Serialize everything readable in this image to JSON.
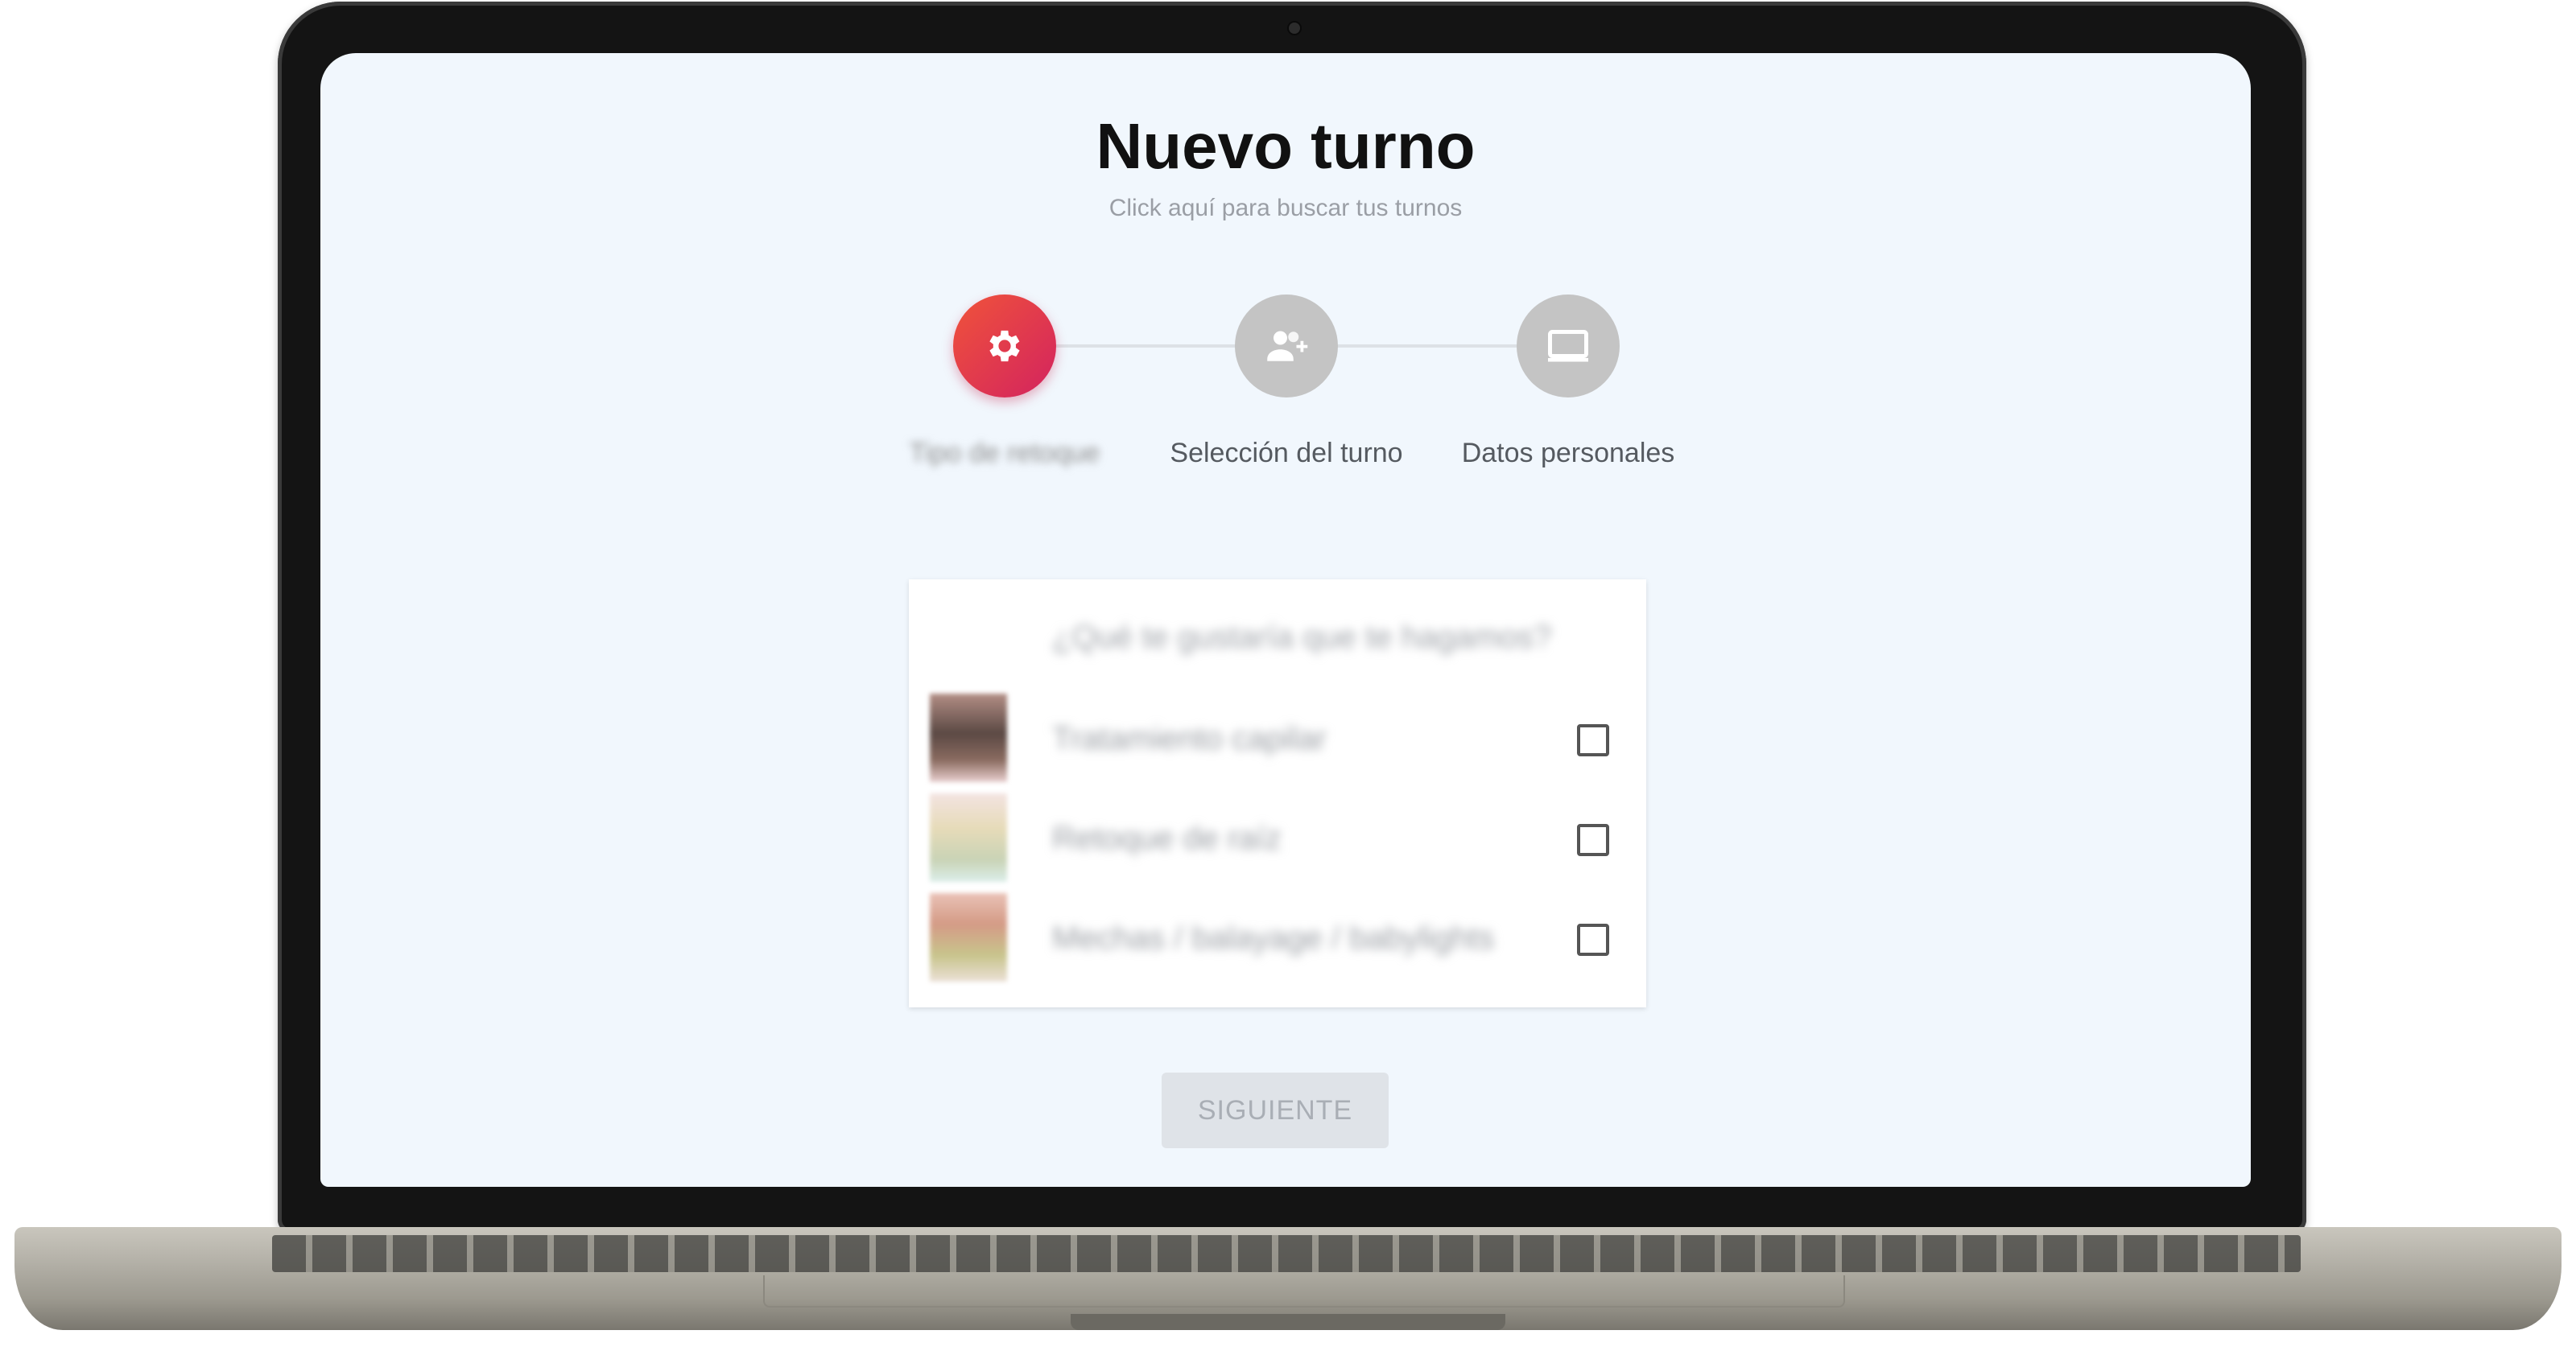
{
  "page": {
    "title": "Nuevo turno",
    "subtitle": "Click aquí para buscar tus turnos"
  },
  "stepper": {
    "steps": [
      {
        "label": "Tipo de retoque",
        "icon": "gear-icon",
        "state": "active"
      },
      {
        "label": "Selección del turno",
        "icon": "person-add-icon",
        "state": "inactive"
      },
      {
        "label": "Datos personales",
        "icon": "monitor-icon",
        "state": "inactive"
      }
    ]
  },
  "services": {
    "question": "¿Qué te gustaría que te hagamos?",
    "items": [
      {
        "name": "Tratamiento capilar",
        "checked": false
      },
      {
        "name": "Retoque de raíz",
        "checked": false
      },
      {
        "name": "Mechas / balayage / babylights",
        "checked": false
      }
    ]
  },
  "actions": {
    "next_label": "SIGUIENTE"
  },
  "colors": {
    "active_step": "#e8394c",
    "inactive_step": "#c4c4c4",
    "screen_background": "#f1f7fd"
  }
}
